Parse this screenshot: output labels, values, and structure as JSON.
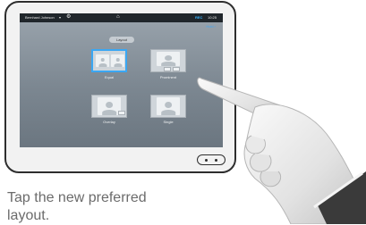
{
  "topbar": {
    "user": "Bernhard Johnson",
    "record_label": "REC",
    "time": "10:25"
  },
  "subbar": {
    "text": "Hold ›"
  },
  "layout_pill": {
    "label": "Layout"
  },
  "layouts": [
    {
      "label": "Equal",
      "selected": true
    },
    {
      "label": "Prominent",
      "selected": false
    },
    {
      "label": "Overlay",
      "selected": false
    },
    {
      "label": "Single",
      "selected": false
    }
  ],
  "caption": {
    "line1": "Tap the new preferred",
    "line2": "layout."
  }
}
